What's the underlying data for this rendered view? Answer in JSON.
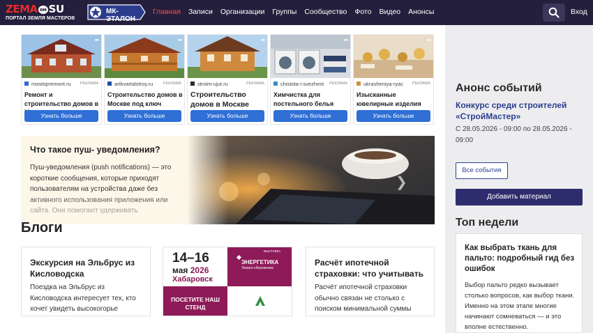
{
  "header": {
    "logo_main_prefix": "ZEMA",
    "logo_main_suffix": "SU",
    "logo_dot": "ем",
    "logo_sub": "ПОРТАЛ ЗЕМЛЯ МАСТЕРОВ",
    "badge": "МК-ЭТАЛОН",
    "nav": [
      "Главная",
      "Записи",
      "Организации",
      "Группы",
      "Сообщество",
      "Фото",
      "Видео",
      "Анонсы"
    ],
    "login": "Вход"
  },
  "ads": [
    {
      "domain": "mostopremont.ru",
      "tag": "РЕКЛАМА",
      "title": "Ремонт и строительство домов в Москве",
      "button": "Узнать больше"
    },
    {
      "domain": "artkvartalstroy.ru",
      "tag": "РЕКЛАМА",
      "title": "Строительство домов в Москве под ключ",
      "button": "Узнать больше"
    },
    {
      "domain": "stroim-ujut.ru",
      "tag": "РЕКЛАМА",
      "title": "Строительство домов в Москве",
      "button": "Узнать больше"
    },
    {
      "domain": "chistota-i-svezhest",
      "tag": "РЕКЛАМА",
      "title": "Химчистка для постельного белья",
      "button": "Узнать больше"
    },
    {
      "domain": "ukrasheniya-ryac",
      "tag": "РЕКЛАМА",
      "title": "Изысканные ювелирные изделия",
      "button": "Узнать больше"
    }
  ],
  "push": {
    "title": "Что такое пуш- уведомления?",
    "text": "Пуш-уведомления (push notifications) — это короткие сообщения, которые приходят пользователям на устройства даже без активного использования приложения или сайта. Они помогают удерживать"
  },
  "blogs": {
    "heading": "Блоги",
    "cards": [
      {
        "title": "Экскурсия на Эльбрус из Кисловодска",
        "text": "Поездка на Эльбрус из Кисловодска интересует тех, кто хочет увидеть высокогорье"
      },
      {
        "title": "Расчёт ипотечной страховки: что учитывать",
        "text": "Расчёт ипотечной страховки обычно связан не столько с поиском минимальной суммы"
      }
    ],
    "expo": {
      "date": "14–16",
      "month": "мая",
      "year": "2026",
      "city": "Хабаровск",
      "exhibition": "ВЫСТАВКА",
      "name": "ЭНЕРГЕТИКА",
      "sub": "Энерго-сбережение",
      "cta": "ПОСЕТИТЕ НАШ СТЕНД"
    }
  },
  "sidebar": {
    "announce_heading": "Анонс событий",
    "event_title": "Конкурс среди строителей «СтройМастер»",
    "event_date": "С 28.05.2026 - 09:00 по 28.05.2026 - 09:00",
    "all_events": "Все события",
    "add_material": "Добавить материал",
    "top_heading": "Топ недели",
    "top_title": "Как выбрать ткань для пальто: подробный гид без ошибок",
    "top_text": "Выбор пальто редко вызывает столько вопросов, как выбор ткани. Именно на этом этапе многие начинают сомневаться — и это вполне естественно."
  },
  "icons": {
    "search": "search-icon",
    "slider_next": "chevron-right-icon"
  },
  "colors": {
    "header_bg": "#241f3c",
    "accent_red": "#e32b2b",
    "button_blue": "#2f6fd6",
    "link_blue": "#2b3f8f",
    "add_button": "#2d2d6e",
    "expo_purple": "#8e1a59"
  }
}
